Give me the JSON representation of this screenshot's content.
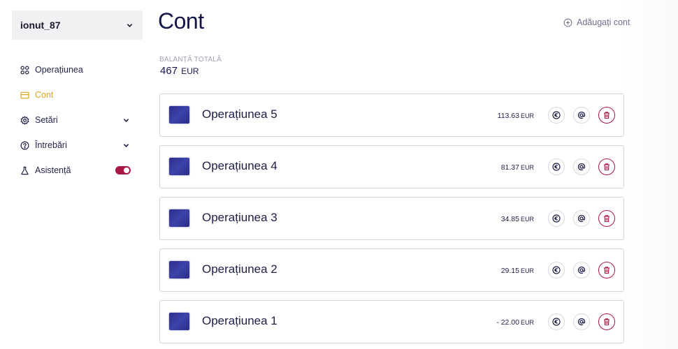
{
  "user": {
    "name": "ionut_87"
  },
  "nav": {
    "items": [
      {
        "label": "Operațiunea",
        "icon": "grid-icon"
      },
      {
        "label": "Cont",
        "icon": "wallet-icon",
        "active": true
      },
      {
        "label": "Setări",
        "icon": "gear-icon"
      },
      {
        "label": "Întrebări",
        "icon": "question-icon"
      },
      {
        "label": "Asistență",
        "icon": "flask-icon",
        "toggle_on": true
      }
    ]
  },
  "page": {
    "title": "Cont",
    "add_account_label": "Adăugați cont"
  },
  "balance": {
    "label": "BALANȚĂ TOTALĂ",
    "value": "467",
    "currency": "EUR"
  },
  "operations": [
    {
      "title": "Operațiunea 5",
      "amount": "113.63",
      "currency": "EUR"
    },
    {
      "title": "Operațiunea 4",
      "amount": "81.37",
      "currency": "EUR"
    },
    {
      "title": "Operațiunea 3",
      "amount": "34.85",
      "currency": "EUR"
    },
    {
      "title": "Operațiunea 2",
      "amount": "29.15",
      "currency": "EUR"
    },
    {
      "title": "Operațiunea 1",
      "amount": "- 22.00",
      "currency": "EUR"
    }
  ],
  "colors": {
    "accent": "#d9a520",
    "danger": "#a81843",
    "text_dark": "#15164a",
    "thumb": "#2f3494"
  }
}
